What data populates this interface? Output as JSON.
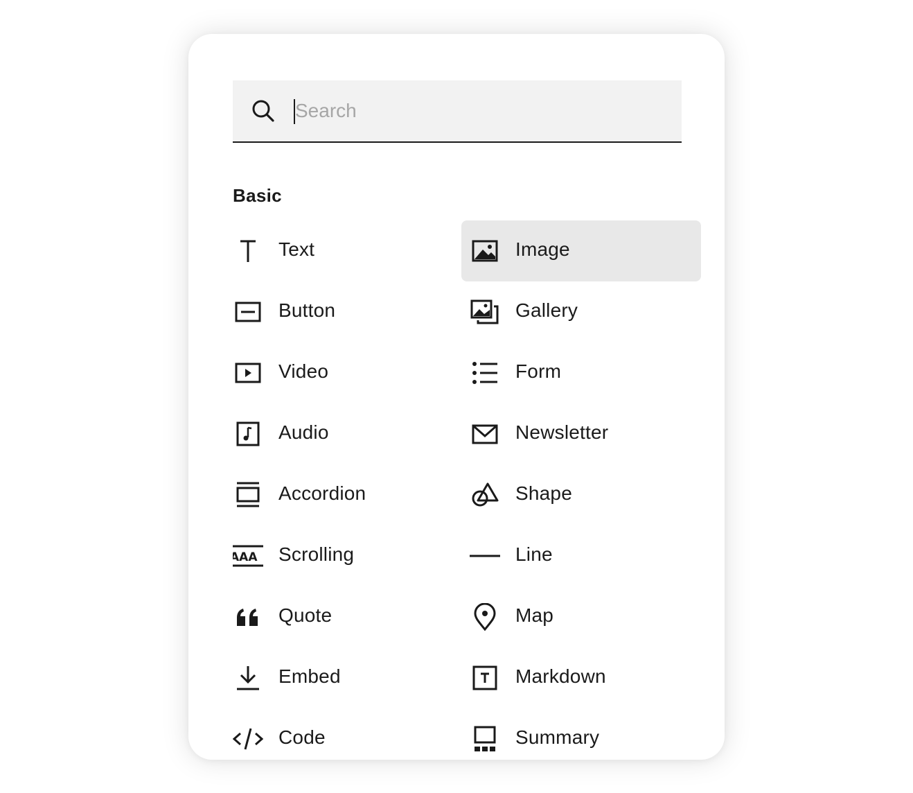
{
  "search": {
    "placeholder": "Search",
    "value": ""
  },
  "section": {
    "title": "Basic"
  },
  "left_items": [
    {
      "label": "Text",
      "icon": "text-icon"
    },
    {
      "label": "Button",
      "icon": "button-icon"
    },
    {
      "label": "Video",
      "icon": "video-icon"
    },
    {
      "label": "Audio",
      "icon": "audio-icon"
    },
    {
      "label": "Accordion",
      "icon": "accordion-icon"
    },
    {
      "label": "Scrolling",
      "icon": "scrolling-icon"
    },
    {
      "label": "Quote",
      "icon": "quote-icon"
    },
    {
      "label": "Embed",
      "icon": "embed-icon"
    },
    {
      "label": "Code",
      "icon": "code-icon"
    }
  ],
  "right_items": [
    {
      "label": "Image",
      "icon": "image-icon",
      "selected": true
    },
    {
      "label": "Gallery",
      "icon": "gallery-icon"
    },
    {
      "label": "Form",
      "icon": "form-icon"
    },
    {
      "label": "Newsletter",
      "icon": "newsletter-icon"
    },
    {
      "label": "Shape",
      "icon": "shape-icon"
    },
    {
      "label": "Line",
      "icon": "line-icon"
    },
    {
      "label": "Map",
      "icon": "map-icon"
    },
    {
      "label": "Markdown",
      "icon": "markdown-icon"
    },
    {
      "label": "Summary",
      "icon": "summary-icon"
    }
  ],
  "colors": {
    "selected_bg": "#e8e8e8",
    "search_bg": "#f2f2f2",
    "text": "#1a1a1a",
    "placeholder": "#a6a6a6"
  }
}
